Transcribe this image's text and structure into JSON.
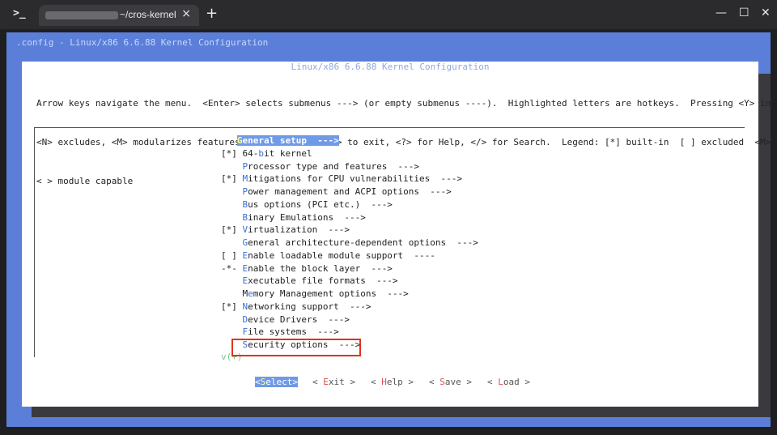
{
  "window": {
    "tab_title": "~/cros-kernel",
    "terminal_icon": ">_",
    "close_tab": "×",
    "new_tab": "+",
    "minimize": "—",
    "maximize": "☐",
    "close": "✕"
  },
  "terminal": {
    "top_title": ".config - Linux/x86 6.6.88 Kernel Configuration",
    "dialog_title": "Linux/x86 6.6.88 Kernel Configuration",
    "help_line1": "Arrow keys navigate the menu.  <Enter> selects submenus ---> (or empty submenus ----).  Highlighted letters are hotkeys.  Pressing <Y> includes,",
    "help_line2": "<N> excludes, <M> modularizes features.  Press <Esc><Esc> to exit, <?> for Help, </> for Search.  Legend: [*] built-in  [ ] excluded  <M> module",
    "help_line3": "< > module capable",
    "menu": [
      {
        "prefix": "   ",
        "hotkey": "G",
        "rest": "eneral setup  --->",
        "selected": true
      },
      {
        "prefix": "[*] ",
        "pre": "64-",
        "hotkey": "b",
        "rest": "it kernel"
      },
      {
        "prefix": "    ",
        "hotkey": "P",
        "rest": "rocessor type and features  --->"
      },
      {
        "prefix": "[*] ",
        "hotkey": "M",
        "rest": "itigations for CPU vulnerabilities  --->"
      },
      {
        "prefix": "    ",
        "hotkey": "P",
        "rest": "ower management and ACPI options  --->"
      },
      {
        "prefix": "    ",
        "hotkey": "B",
        "rest": "us options (PCI etc.)  --->"
      },
      {
        "prefix": "    ",
        "hotkey": "B",
        "rest": "inary Emulations  --->"
      },
      {
        "prefix": "[*] ",
        "hotkey": "V",
        "rest": "irtualization  --->"
      },
      {
        "prefix": "    ",
        "hotkey": "G",
        "rest": "eneral architecture-dependent options  --->"
      },
      {
        "prefix": "[ ] ",
        "hotkey": "E",
        "rest": "nable loadable module support  ----"
      },
      {
        "prefix": "-*- ",
        "hotkey": "E",
        "rest": "nable the block layer  --->"
      },
      {
        "prefix": "    ",
        "hotkey": "E",
        "rest": "xecutable file formats  --->"
      },
      {
        "prefix": "    ",
        "pre": "M",
        "hotkey": "e",
        "rest": "mory Management options  --->"
      },
      {
        "prefix": "[*] ",
        "hotkey": "N",
        "rest": "etworking support  --->"
      },
      {
        "prefix": "    ",
        "hotkey": "D",
        "rest": "evice Drivers  --->"
      },
      {
        "prefix": "    ",
        "hotkey": "F",
        "rest": "ile systems  --->"
      },
      {
        "prefix": "    ",
        "hotkey": "S",
        "rest": "ecurity options  --->"
      }
    ],
    "more_indicator": "v(+)",
    "buttons": {
      "select": {
        "pre": "<",
        "hotkey": "S",
        "rest": "elect>"
      },
      "exit": {
        "pre": "< ",
        "hotkey": "E",
        "rest": "xit >"
      },
      "help": {
        "pre": "< ",
        "hotkey": "H",
        "rest": "elp >"
      },
      "save": {
        "pre": "< ",
        "hotkey": "S",
        "rest": "ave >"
      },
      "load": {
        "pre": "< ",
        "hotkey": "L",
        "rest": "oad >"
      }
    }
  },
  "colors": {
    "background_blue": "#5b7fd9",
    "selection": "#6f9ae8",
    "highlight_box": "#e0341c"
  }
}
